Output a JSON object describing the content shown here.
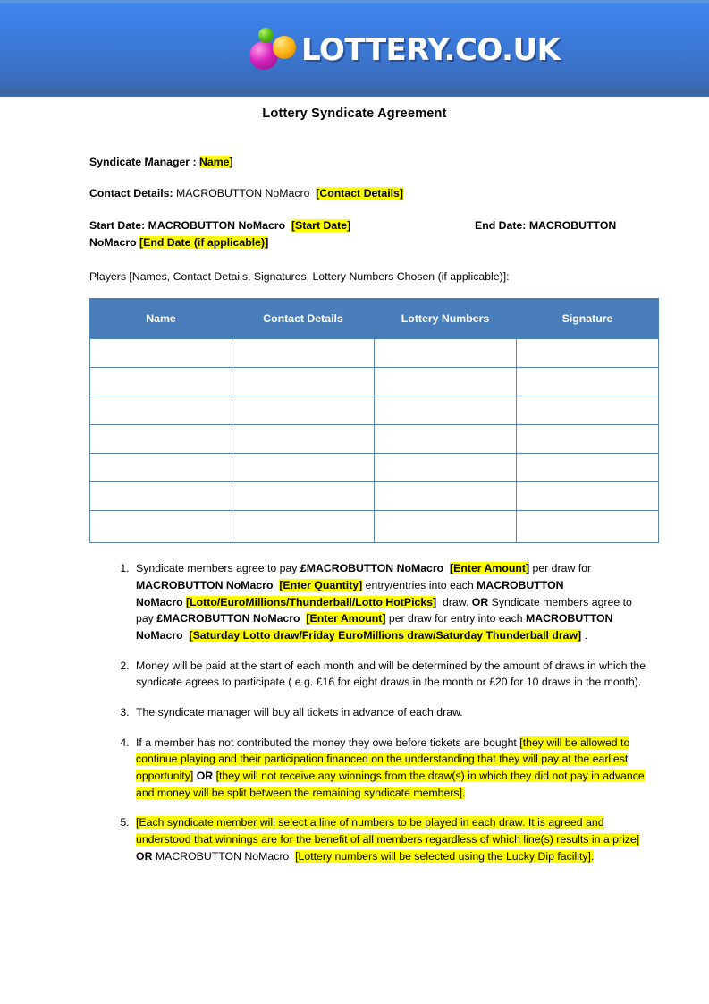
{
  "brand": {
    "wordmark": "LOTTERY.CO.UK",
    "ball_green": "#59c21a",
    "ball_orange": "#ffb81b",
    "ball_magenta": "#d621bd",
    "banner_color_top": "#3f86f0",
    "banner_color_bottom": "#3a6cb5"
  },
  "document": {
    "title": "Lottery Syndicate Agreement",
    "highlight_color": "#ffff00",
    "table_header_color": "#4a7ebb"
  },
  "fields": {
    "manager_label": "Syndicate Manager : ",
    "manager_value": "Name",
    "manager_close_bracket": "]",
    "contact_label": "Contact Details:  ",
    "contact_macro": "MACROBUTTON NoMacro",
    "contact_value": "[Contact Details]",
    "start_label": "Start  Date:  ",
    "start_macro": "MACROBUTTON NoMacro",
    "start_value": "[Start Date]",
    "end_label": "End Date:  ",
    "end_macro_part1": "MACROBUTTON",
    "end_macro_part2": "NoMacro ",
    "end_value": "[End Date (if applicable)]"
  },
  "players": {
    "caption": "Players [Names, Contact Details, Signatures, Lottery Numbers Chosen (if applicable)]:",
    "columns": [
      "Name",
      "Contact Details",
      "Lottery Numbers",
      "Signature"
    ],
    "empty_row_count": 7
  },
  "terms": {
    "item1": {
      "s1": "Syndicate members agree to pay ",
      "s2": "£MACROBUTTON NoMacro",
      "s3": "[Enter Amount]",
      "s4": " per draw for ",
      "s5": "MACROBUTTON NoMacro",
      "s6": "[Enter Quantity]",
      "s7": " entry/entries into each ",
      "s8": "MACROBUTTON NoMacro",
      "s9": "[Lotto/EuroMillions/Thunderball/Lotto HotPicks]",
      "s10": " draw. ",
      "s11": "OR",
      "s12": " Syndicate members agree to pay ",
      "s13": "£MACROBUTTON NoMacro",
      "s14": "[Enter Amount]",
      "s15": " per draw for entry into each ",
      "s16": "MACROBUTTON NoMacro",
      "s17": "[Saturday Lotto draw/Friday EuroMillions draw/Saturday Thunderball draw]",
      "s18": " ."
    },
    "item2": "Money will be paid at the start of each month and will be determined by the amount of draws in which the syndicate agrees to participate ( e.g. £16 for eight draws in the month or £20 for 10 draws in the month).",
    "item3": "The syndicate manager will buy all tickets in advance of each draw.",
    "item4": {
      "s1": "If a member has not contributed the money they owe before tickets are bought ",
      "s2": "[they will be allowed to continue playing and their participation financed on the understanding that they will pay at the earliest opportunity]",
      "s3": "OR",
      "s4": "[they will not receive any winnings from the draw(s) in which they did not pay in advance and money will be split between the remaining syndicate members].",
      "sp": " "
    },
    "item5": {
      "s1": "[Each syndicate member will select a line of numbers to be played in each draw. It is agreed and understood that winnings are for the benefit of all members regardless of which line(s) results in a prize]",
      "s2": "OR",
      "s3": "MACROBUTTON NoMacro",
      "s4": "[Lottery numbers will be selected using the Lucky Dip facility].",
      "sp": " "
    }
  }
}
